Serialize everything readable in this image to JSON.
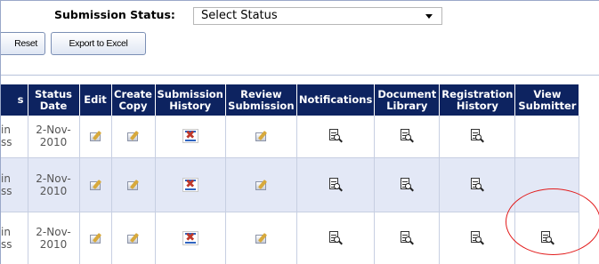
{
  "filter": {
    "label": "Submission Status:",
    "selected": "Select Status"
  },
  "toolbar": {
    "reset_label": "Reset",
    "export_label": "Export to Excel"
  },
  "table": {
    "columns": [
      {
        "id": "status",
        "line1": "s",
        "line2": ""
      },
      {
        "id": "status_date",
        "line1": "Status",
        "line2": "Date"
      },
      {
        "id": "edit",
        "line1": "Edit",
        "line2": ""
      },
      {
        "id": "create_copy",
        "line1": "Create",
        "line2": "Copy"
      },
      {
        "id": "submission_history",
        "line1": "Submission",
        "line2": "History"
      },
      {
        "id": "review_submission",
        "line1": "Review",
        "line2": "Submission"
      },
      {
        "id": "notifications",
        "line1": "Notifications",
        "line2": ""
      },
      {
        "id": "document_library",
        "line1": "Document",
        "line2": "Library"
      },
      {
        "id": "registration_history",
        "line1": "Registration",
        "line2": "History"
      },
      {
        "id": "view_submitter",
        "line1": "View",
        "line2": "Submitter"
      }
    ],
    "rows": [
      {
        "status_line1": "in",
        "status_line2": "ss",
        "date_line1": "2-Nov-",
        "date_line2": "2010",
        "view_submitter": false
      },
      {
        "status_line1": "in",
        "status_line2": "ss",
        "date_line1": "2-Nov-",
        "date_line2": "2010",
        "view_submitter": false
      },
      {
        "status_line1": "in",
        "status_line2": "ss",
        "date_line1": "2-Nov-",
        "date_line2": "2010",
        "view_submitter": true
      }
    ]
  },
  "icons": {
    "edit": "edit-note-icon",
    "create_copy": "copy-note-icon",
    "submission_history": "history-icon",
    "review_submission": "review-note-icon",
    "notifications": "document-magnifier-icon",
    "document_library": "document-magnifier-icon",
    "registration_history": "document-magnifier-icon",
    "view_submitter": "document-magnifier-icon"
  },
  "colors": {
    "header_bg": "#0d2360",
    "row_alt_bg": "#e3e8f6",
    "annotation": "#e21b1b"
  }
}
